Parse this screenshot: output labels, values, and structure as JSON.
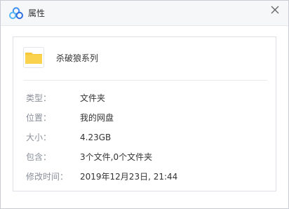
{
  "dialog": {
    "title": "属性",
    "close_icon": "close-icon",
    "app_icon": "cloud-logo-icon"
  },
  "file": {
    "name": "杀破狼系列",
    "icon": "folder-icon",
    "icon_color": "#f7c83a"
  },
  "properties": [
    {
      "label": "类型：",
      "value": "文件夹"
    },
    {
      "label": "位置：",
      "value": "我的网盘"
    },
    {
      "label": "大小：",
      "value": "4.23GB"
    },
    {
      "label": "包含：",
      "value": "3个文件,0个文件夹"
    },
    {
      "label": "修改时间：",
      "value": "2019年12月23日, 21:44"
    }
  ]
}
